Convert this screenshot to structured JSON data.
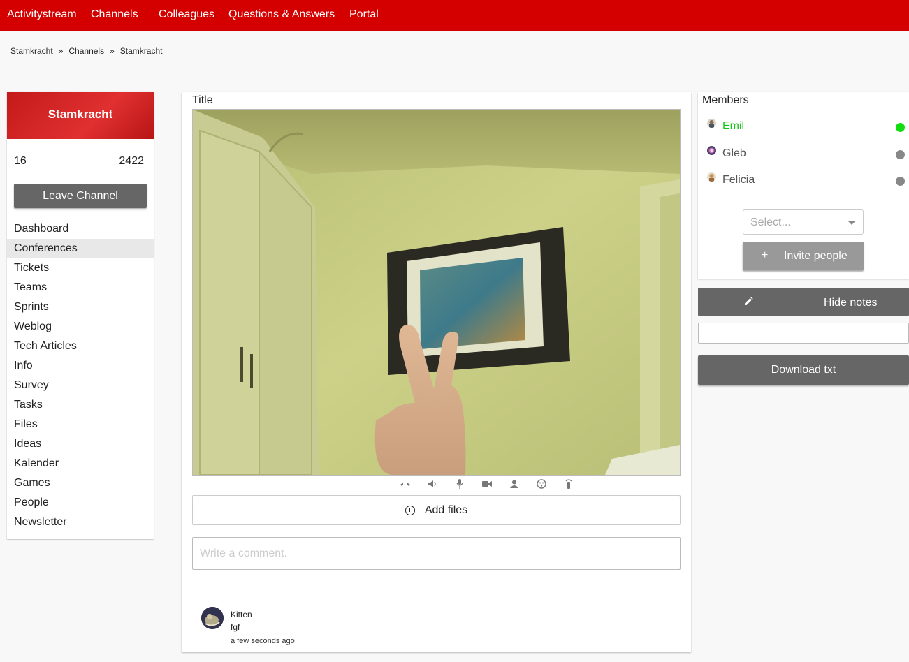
{
  "nav": {
    "items": [
      "Activitystream",
      "Channels",
      "Colleagues",
      "Questions & Answers",
      "Portal"
    ],
    "background": "#d40000"
  },
  "breadcrumb": [
    "Stamkracht",
    "Channels",
    "Stamkracht"
  ],
  "breadcrumb_separator": "»",
  "channel": {
    "name": "Stamkracht",
    "stat_left": "16",
    "stat_right": "2422",
    "leave_label": "Leave Channel",
    "menu": [
      "Dashboard",
      "Conferences",
      "Tickets",
      "Teams",
      "Sprints",
      "Weblog",
      "Tech Articles",
      "Info",
      "Survey",
      "Tasks",
      "Files",
      "Ideas",
      "Kalender",
      "Games",
      "People",
      "Newsletter"
    ],
    "active_menu": "Conferences"
  },
  "conference": {
    "title": "Title",
    "controls": [
      "hangup-icon",
      "speaker-icon",
      "microphone-icon",
      "camera-icon",
      "person-icon",
      "face-icon",
      "remote-icon"
    ],
    "add_files_label": "Add files",
    "comment_placeholder": "Write a comment.",
    "comment": {
      "author": "Kitten",
      "text": "fgf",
      "time": "a few seconds ago"
    }
  },
  "members": {
    "title": "Members",
    "list": [
      {
        "name": "Emil",
        "status": "online"
      },
      {
        "name": "Gleb",
        "status": "offline"
      },
      {
        "name": "Felicia",
        "status": "offline"
      }
    ],
    "select_placeholder": "Select...",
    "invite_plus": "+",
    "invite_label": "Invite people"
  },
  "notes": {
    "hide_label": "Hide notes",
    "download_label": "Download txt"
  },
  "colors": {
    "accent": "#d40000",
    "online": "#11dd11",
    "offline": "#888888",
    "button": "#666666"
  }
}
